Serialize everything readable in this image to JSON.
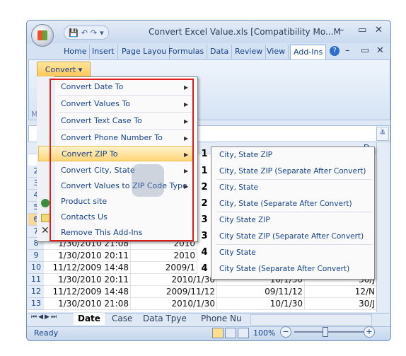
{
  "window": {
    "title": "Convert Excel Value.xls  [Compatibility Mo...M",
    "min": "–",
    "max": "▭",
    "close": "✕",
    "inner_min": "–",
    "inner_max": "▭",
    "inner_close": "✕"
  },
  "qat": {
    "save": "💾",
    "undo": "↶",
    "redo": "↷",
    "dropdown": "▾"
  },
  "ribbon_tabs": [
    "Home",
    "Insert",
    "Page Layou",
    "Formulas",
    "Data",
    "Review",
    "View",
    "Add-Ins"
  ],
  "help": "?",
  "convert_button": {
    "label": "Convert",
    "caret": "▾"
  },
  "ribbon_fragment": "M",
  "menu_items": [
    {
      "label": "Convert Date To",
      "arrow": "▶"
    },
    {
      "label": "Convert Values To",
      "arrow": "▶"
    },
    {
      "label": "Convert Text Case To",
      "arrow": "▶"
    },
    {
      "label": "Convert Phone Number To",
      "arrow": "▶"
    },
    {
      "label": "Convert ZIP To",
      "arrow": "▶"
    },
    {
      "label": "Convert City, State",
      "arrow": "▶"
    },
    {
      "label": "Convert Values to ZIP Code Type",
      "arrow": "▶"
    },
    {
      "label": "Product site"
    },
    {
      "label": "Contacts Us"
    },
    {
      "label": "Remove This Add-Ins"
    }
  ],
  "submenu_items": [
    {
      "num": "1",
      "label": "City, State ZIP"
    },
    {
      "num": "1",
      "label": "City, State ZIP (Separate After Convert)"
    },
    {
      "num": "2",
      "label": "City, State"
    },
    {
      "num": "2",
      "label": "City, State (Separate After Convert)"
    },
    {
      "num": "3",
      "label": "City State ZIP"
    },
    {
      "num": "3",
      "label": "City State ZIP (Separate After Convert)"
    },
    {
      "num": "4",
      "label": "City State"
    },
    {
      "num": "4",
      "label": "City State (Separate After Convert)"
    }
  ],
  "column_letter": "D",
  "row_numbers": [
    "2",
    "3",
    "4",
    "5",
    "6",
    "7",
    "8",
    "9",
    "10",
    "11",
    "12",
    "13"
  ],
  "rows": [
    {
      "n": "8",
      "a": "1/30/2010 21:08",
      "b": "2010",
      "c": "",
      "d": ""
    },
    {
      "n": "9",
      "a": "1/30/2010 20:11",
      "b": "2010",
      "c": "",
      "d": ""
    },
    {
      "n": "10",
      "a": "11/12/2009 14:48",
      "b": "2009/1",
      "c": "",
      "d": ""
    },
    {
      "n": "11",
      "a": "1/30/2010 20:11",
      "b": "2010/1/30",
      "c": "10/1/30",
      "d": "30/J"
    },
    {
      "n": "12",
      "a": "11/12/2009 14:48",
      "b": "2009/11/12",
      "c": "09/11/12",
      "d": "12/N"
    },
    {
      "n": "13",
      "a": "1/30/2010 21:08",
      "b": "2010/1/30",
      "c": "10/1/30",
      "d": "30/J"
    }
  ],
  "right_column_fragments": [
    "30/J"
  ],
  "sheet_tabs": [
    "Date",
    "Case",
    "Data Tpye",
    "Phone Nu"
  ],
  "status": {
    "ready": "Ready",
    "zoom": "100%",
    "minus": "−",
    "plus": "+"
  }
}
